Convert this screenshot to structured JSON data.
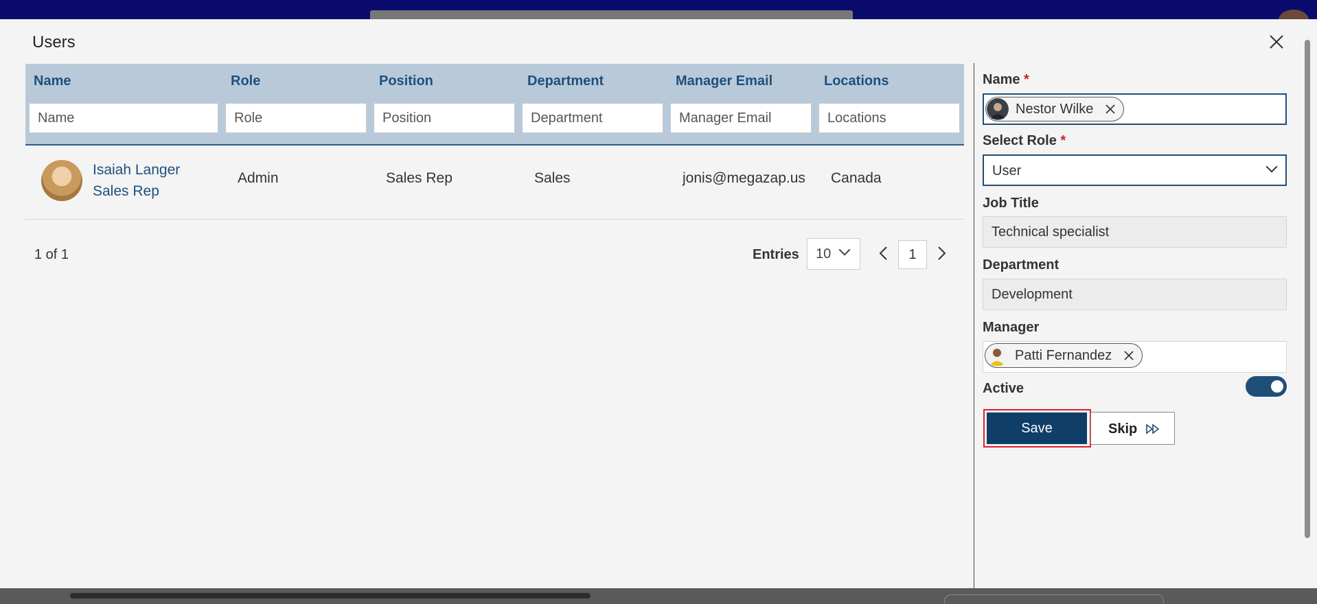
{
  "modal": {
    "title": "Users"
  },
  "table": {
    "columns": [
      {
        "label": "Name",
        "placeholder": "Name"
      },
      {
        "label": "Role",
        "placeholder": "Role"
      },
      {
        "label": "Position",
        "placeholder": "Position"
      },
      {
        "label": "Department",
        "placeholder": "Department"
      },
      {
        "label": "Manager Email",
        "placeholder": "Manager Email"
      },
      {
        "label": "Locations",
        "placeholder": "Locations"
      }
    ],
    "rows": [
      {
        "name": "Isaiah Langer",
        "subtitle": "Sales Rep",
        "role": "Admin",
        "position": "Sales Rep",
        "department": "Sales",
        "manager_email": "jonis@megazap.us",
        "location": "Canada"
      }
    ]
  },
  "pager": {
    "count": "1 of 1",
    "entries_label": "Entries",
    "entries_value": "10",
    "page": "1"
  },
  "form": {
    "name_label": "Name",
    "name_value": "Nestor Wilke",
    "role_label": "Select Role",
    "role_value": "User",
    "job_title_label": "Job Title",
    "job_title_value": "Technical specialist",
    "department_label": "Department",
    "department_value": "Development",
    "manager_label": "Manager",
    "manager_value": "Patti Fernandez",
    "active_label": "Active",
    "active": true,
    "required_mark": "*",
    "save_label": "Save",
    "skip_label": "Skip"
  },
  "colors": {
    "accent": "#1f4e79",
    "header_bg": "#b8cada",
    "link": "#1e4f7d",
    "required": "#c4262e",
    "highlight": "#e0202a"
  }
}
